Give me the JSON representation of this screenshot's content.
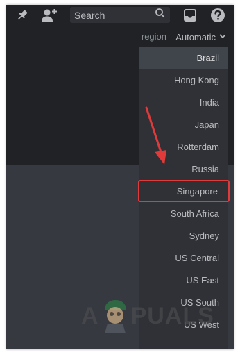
{
  "toolbar": {
    "pin_icon": "pin-icon",
    "add_member_icon": "add-member-icon",
    "search": {
      "placeholder": "Search",
      "icon": "search-icon"
    },
    "inbox_icon": "inbox-icon",
    "help_icon": "help-icon"
  },
  "region": {
    "label": "region",
    "selected": "Automatic"
  },
  "dropdown": {
    "items": [
      {
        "label": "Brazil"
      },
      {
        "label": "Hong Kong"
      },
      {
        "label": "India"
      },
      {
        "label": "Japan"
      },
      {
        "label": "Rotterdam"
      },
      {
        "label": "Russia"
      },
      {
        "label": "Singapore"
      },
      {
        "label": "South Africa"
      },
      {
        "label": "Sydney"
      },
      {
        "label": "US Central"
      },
      {
        "label": "US East"
      },
      {
        "label": "US South"
      },
      {
        "label": "US West"
      }
    ],
    "hovered_index": 0,
    "highlighted_index": 6
  },
  "annotation": {
    "arrow_color": "#e03a3a",
    "highlight_color": "#e03a3a"
  },
  "watermark": {
    "left": "A",
    "right": "PUALS"
  },
  "colors": {
    "topbar": "#202225",
    "content": "#36393f",
    "dropdown": "#2f3136",
    "text": "#b9bbbe"
  }
}
